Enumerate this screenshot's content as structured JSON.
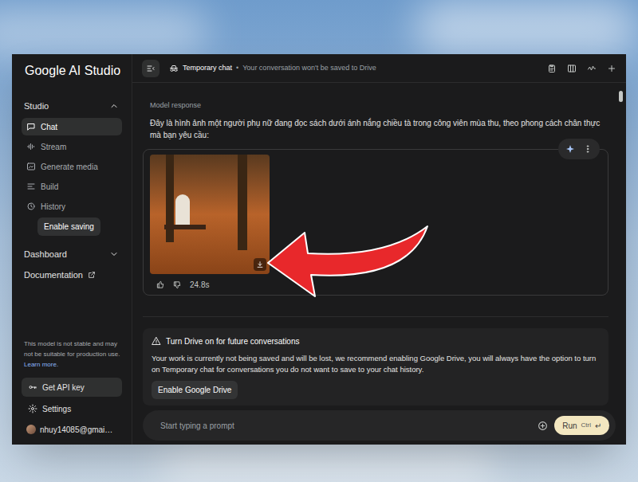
{
  "app": {
    "title": "Google AI Studio"
  },
  "sidebar": {
    "studio": {
      "label": "Studio",
      "expanded": true
    },
    "items": [
      {
        "label": "Chat",
        "selected": true
      },
      {
        "label": "Stream",
        "selected": false
      },
      {
        "label": "Generate media",
        "selected": false
      },
      {
        "label": "Build",
        "selected": false
      },
      {
        "label": "History",
        "selected": false
      }
    ],
    "enable_saving": "Enable saving",
    "dashboard": {
      "label": "Dashboard",
      "expanded": false
    },
    "documentation": "Documentation",
    "notice": {
      "text": "This model is not stable and may not be suitable for production use.",
      "link": "Learn more."
    },
    "api_key": "Get API key",
    "settings": "Settings",
    "account": "nhuy14085@gmai…"
  },
  "header": {
    "chat_type": "Temporary chat",
    "separator": "•",
    "note": "Your conversation won't be saved to Drive"
  },
  "response": {
    "label": "Model response",
    "text": "Đây là hình ảnh một người phụ nữ đang đọc sách dưới ánh nắng chiều tà trong công viên mùa thu, theo phong cách chân thực mà bạn yêu cầu:",
    "duration": "24.8s"
  },
  "drive_notice": {
    "title": "Turn Drive on for future conversations",
    "text": "Your work is currently not being saved and will be lost, we recommend enabling Google Drive, you will always have the option to turn on Temporary chat for conversations you do not want to save to your chat history.",
    "button": "Enable Google Drive"
  },
  "prompt": {
    "placeholder": "Start typing a prompt",
    "run": "Run",
    "shortcut": "Ctrl",
    "shortcut_key": "↵"
  }
}
